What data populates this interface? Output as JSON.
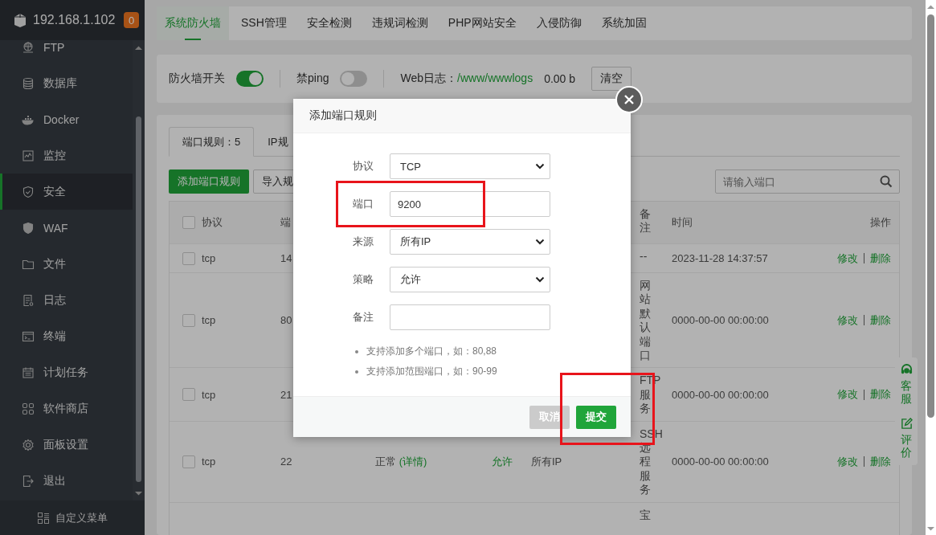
{
  "sidebar": {
    "host": "192.168.1.102",
    "badge": "0",
    "items": [
      {
        "label": "FTP",
        "selected": false
      },
      {
        "label": "数据库",
        "selected": false
      },
      {
        "label": "Docker",
        "selected": false
      },
      {
        "label": "监控",
        "selected": false
      },
      {
        "label": "安全",
        "selected": true
      },
      {
        "label": "WAF",
        "selected": false
      },
      {
        "label": "文件",
        "selected": false
      },
      {
        "label": "日志",
        "selected": false
      },
      {
        "label": "终端",
        "selected": false
      },
      {
        "label": "计划任务",
        "selected": false
      },
      {
        "label": "软件商店",
        "selected": false
      },
      {
        "label": "面板设置",
        "selected": false
      },
      {
        "label": "退出",
        "selected": false
      }
    ],
    "footer": "自定义菜单"
  },
  "tabs": [
    {
      "label": "系统防火墙",
      "selected": true
    },
    {
      "label": "SSH管理",
      "selected": false
    },
    {
      "label": "安全检测",
      "selected": false
    },
    {
      "label": "违规词检测",
      "selected": false
    },
    {
      "label": "PHP网站安全",
      "selected": false
    },
    {
      "label": "入侵防御",
      "selected": false
    },
    {
      "label": "系统加固",
      "selected": false
    }
  ],
  "toolbar": {
    "switches": [
      {
        "label": "防火墙开关",
        "on": true
      },
      {
        "label": "禁ping",
        "on": false
      }
    ],
    "log_label": "Web日志：",
    "log_path": "/www/wwwlogs",
    "log_size": "0.00 b",
    "clear_button": "清空"
  },
  "rules": {
    "tabs": [
      {
        "label": "端口规则：5",
        "selected": true
      },
      {
        "label": "IP规",
        "selected": false
      }
    ],
    "add_button": "添加端口规则",
    "import_button": "导入规",
    "search": {
      "placeholder": "请输入端口"
    },
    "table": {
      "header": {
        "checked": false,
        "protocol": "协议",
        "port": "端",
        "note": "备注",
        "time": "时间",
        "actions": "操作"
      },
      "rows": [
        {
          "checked": false,
          "protocol": "tcp",
          "port": "14",
          "note": "--",
          "time": "2023-11-28 14:37:57",
          "edit": "修改",
          "delete": "删除"
        },
        {
          "checked": false,
          "protocol": "tcp",
          "port": "80",
          "note": "网站默认端口",
          "time": "0000-00-00 00:00:00",
          "edit": "修改",
          "delete": "删除"
        },
        {
          "checked": false,
          "protocol": "tcp",
          "port": "21",
          "note": "FTP服务",
          "time": "0000-00-00 00:00:00",
          "edit": "修改",
          "delete": "删除"
        },
        {
          "checked": false,
          "protocol": "tcp",
          "port": "22",
          "status": "正常",
          "detail_link": "(详情)",
          "policy": "允许",
          "source": "所有IP",
          "note": "SSH远程服务",
          "time": "0000-00-00 00:00:00",
          "edit": "修改",
          "delete": "删除"
        },
        {
          "note": "宝"
        }
      ]
    }
  },
  "side_panel": [
    {
      "label": "客服"
    },
    {
      "label": "评价"
    }
  ],
  "dialog": {
    "title": "添加端口规则",
    "fields": [
      {
        "label": "协议",
        "kind": "select",
        "value": "TCP"
      },
      {
        "label": "端口",
        "kind": "input",
        "value": "9200"
      },
      {
        "label": "来源",
        "kind": "select",
        "value": "所有IP"
      },
      {
        "label": "策略",
        "kind": "select",
        "value": "允许"
      },
      {
        "label": "备注",
        "kind": "input"
      }
    ],
    "notes": [
      "支持添加多个端口，如：80,88",
      "支持添加范围端口，如：90-99"
    ],
    "cancel_button": "取消",
    "submit_button": "提交"
  }
}
